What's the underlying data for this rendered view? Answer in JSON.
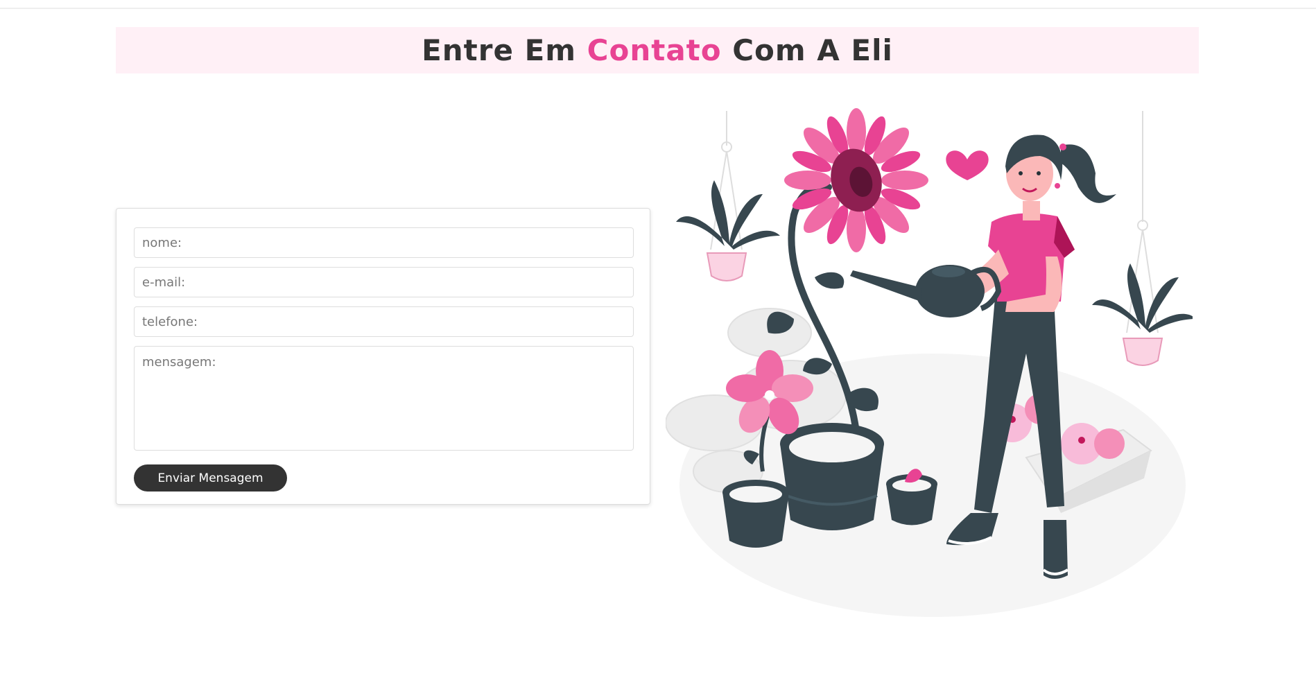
{
  "header": {
    "title_before": "Entre Em ",
    "title_accent": "Contato",
    "title_after": " Com A Eli"
  },
  "form": {
    "name_placeholder": "nome:",
    "email_placeholder": "e-mail:",
    "phone_placeholder": "telefone:",
    "message_placeholder": "mensagem:",
    "submit_label": "Enviar Mensagem"
  },
  "colors": {
    "accent": "#e84393",
    "heading_bg": "#fff0f6",
    "text_dark": "#333333",
    "plant_dark": "#37474f"
  },
  "illustration": {
    "icon": "woman-watering-plants-illustration"
  }
}
